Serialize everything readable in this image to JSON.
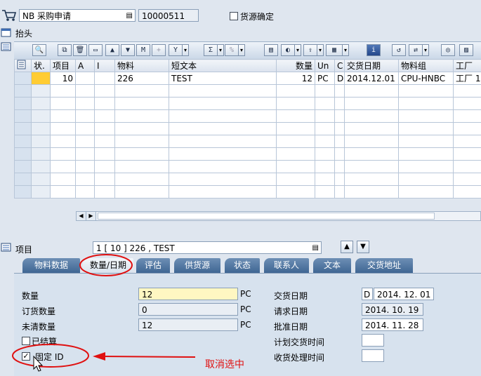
{
  "header": {
    "doc_type_value": "NB 采购申请",
    "doc_number": "10000511",
    "source_determination_label": "货源确定",
    "source_determination_checked": false,
    "section_label": "抬头"
  },
  "table": {
    "columns": [
      "状.",
      "项目",
      "A",
      "I",
      "物料",
      "短文本",
      "数量",
      "Un",
      "C",
      "交货日期",
      "物料组",
      "工厂"
    ],
    "rows": [
      [
        "",
        "10",
        "",
        "",
        "226",
        "TEST",
        "12",
        "PC",
        "D",
        "2014.12.01",
        "CPU-HNBC",
        "工厂 1"
      ]
    ],
    "scroll_left": "◀",
    "scroll_right": "▶"
  },
  "item": {
    "label": "项目",
    "value": "1 [ 10 ] 226 , TEST"
  },
  "tabs": [
    "物料数据",
    "数量/日期",
    "评估",
    "供货源",
    "状态",
    "联系人",
    "文本",
    "交货地址"
  ],
  "active_tab": "数量/日期",
  "qty": {
    "quantity_label": "数量",
    "quantity_value": "12",
    "quantity_unit": "PC",
    "ordered_label": "订货数量",
    "ordered_value": "0",
    "ordered_unit": "PC",
    "open_label": "未清数量",
    "open_value": "12",
    "open_unit": "PC",
    "closed_label": "已结算",
    "fixed_id_label": "固定 ID"
  },
  "dates": {
    "delivery_label": "交货日期",
    "delivery_cat": "D",
    "delivery_value": "2014. 12. 01",
    "request_label": "请求日期",
    "request_value": "2014. 10. 19",
    "release_label": "批准日期",
    "release_value": "2014. 11. 28",
    "planned_label": "计划交货时间",
    "planned_value": "",
    "gr_label": "收货处理时间",
    "gr_value": ""
  },
  "annotation": {
    "text": "取消选中",
    "color": "#e01010"
  },
  "colors": {
    "accent_tab": "#4a6f9b",
    "highlight": "#ffcc33"
  }
}
